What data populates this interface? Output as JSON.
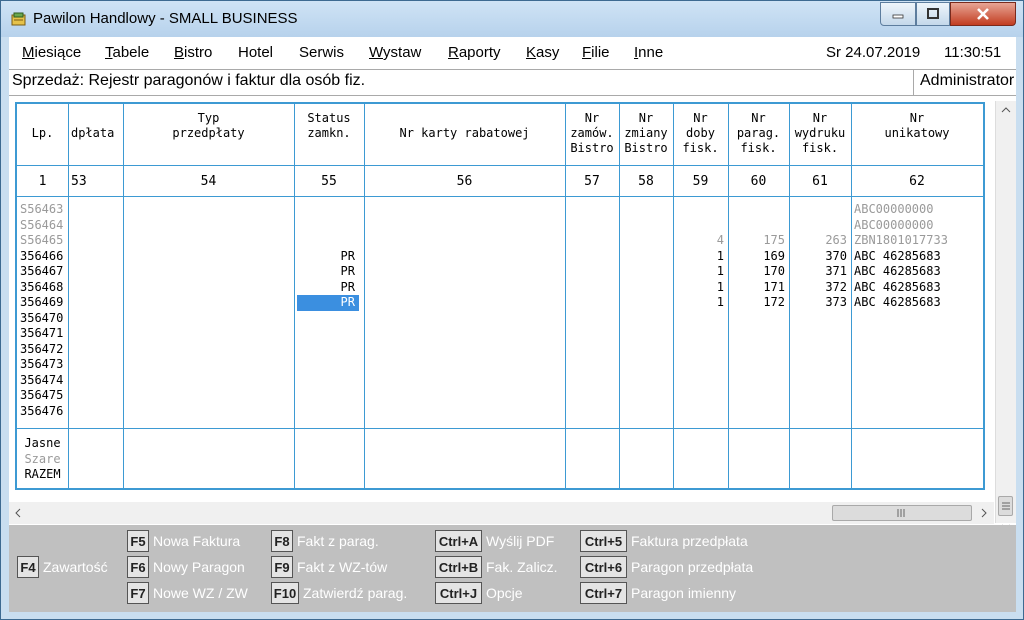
{
  "window": {
    "title": "Pawilon Handlowy - SMALL BUSINESS"
  },
  "menu": {
    "items": [
      {
        "label": "Miesiące",
        "u": "M",
        "rest": "iesiące"
      },
      {
        "label": "Tabele",
        "u": "T",
        "rest": "abele"
      },
      {
        "label": "Bistro",
        "u": "B",
        "rest": "istro"
      },
      {
        "label": "Hotel",
        "u": "",
        "rest": "Hotel"
      },
      {
        "label": "Serwis",
        "u": "",
        "rest": "Serwis"
      },
      {
        "label": "Wystaw",
        "u": "W",
        "rest": "ystaw"
      },
      {
        "label": "Raporty",
        "u": "R",
        "rest": "aporty"
      },
      {
        "label": "Kasy",
        "u": "K",
        "rest": "asy"
      },
      {
        "label": "Filie",
        "u": "F",
        "rest": "ilie"
      },
      {
        "label": "Inne",
        "u": "I",
        "rest": "nne"
      }
    ],
    "date": "Sr 24.07.2019",
    "time": "11:30:51"
  },
  "status": {
    "title": "Sprzedaż: Rejestr paragonów i faktur dla osób fiz.",
    "user": "Administrator"
  },
  "grid": {
    "headers": [
      "Lp.",
      "dpłata",
      "Typ\nprzedpłaty",
      "Status\nzamkn.",
      "Nr karty rabatowej",
      "Nr\nzamów.\nBistro",
      "Nr\nzmiany\nBistro",
      "Nr\ndoby\nfisk.",
      "Nr\nparag.\nfisk.",
      "Nr\nwydruku\nfisk.",
      "Nr\nunikatowy"
    ],
    "numbers": [
      "1",
      "53",
      "54",
      "55",
      "56",
      "57",
      "58",
      "59",
      "60",
      "61",
      "62"
    ],
    "rows": [
      {
        "lp": "S56463",
        "status": "",
        "doby": "",
        "parag": "",
        "wydruk": "",
        "unik": "ABC00000000",
        "grey": true
      },
      {
        "lp": "S56464",
        "status": "",
        "doby": "",
        "parag": "",
        "wydruk": "",
        "unik": "ABC00000000",
        "grey": true
      },
      {
        "lp": "S56465",
        "status": "",
        "doby": "4",
        "parag": "175",
        "wydruk": "263",
        "unik": "ZBN1801017733",
        "grey": true
      },
      {
        "lp": "356466",
        "status": "PR",
        "doby": "1",
        "parag": "169",
        "wydruk": "370",
        "unik": "ABC 46285683",
        "grey": false
      },
      {
        "lp": "356467",
        "status": "PR",
        "doby": "1",
        "parag": "170",
        "wydruk": "371",
        "unik": "ABC 46285683",
        "grey": false
      },
      {
        "lp": "356468",
        "status": "PR",
        "doby": "1",
        "parag": "171",
        "wydruk": "372",
        "unik": "ABC 46285683",
        "grey": false
      },
      {
        "lp": "356469",
        "status": "PR",
        "doby": "1",
        "parag": "172",
        "wydruk": "373",
        "unik": "ABC 46285683",
        "grey": false,
        "selected": true
      },
      {
        "lp": "356470",
        "status": "",
        "doby": "",
        "parag": "",
        "wydruk": "",
        "unik": "",
        "grey": false
      },
      {
        "lp": "356471",
        "status": "",
        "doby": "",
        "parag": "",
        "wydruk": "",
        "unik": "",
        "grey": false
      },
      {
        "lp": "356472",
        "status": "",
        "doby": "",
        "parag": "",
        "wydruk": "",
        "unik": "",
        "grey": false
      },
      {
        "lp": "356473",
        "status": "",
        "doby": "",
        "parag": "",
        "wydruk": "",
        "unik": "",
        "grey": false
      },
      {
        "lp": "356474",
        "status": "",
        "doby": "",
        "parag": "",
        "wydruk": "",
        "unik": "",
        "grey": false
      },
      {
        "lp": "356475",
        "status": "",
        "doby": "",
        "parag": "",
        "wydruk": "",
        "unik": "",
        "grey": false
      },
      {
        "lp": "356476",
        "status": "",
        "doby": "",
        "parag": "",
        "wydruk": "",
        "unik": "",
        "grey": false
      }
    ],
    "legend": [
      {
        "label": "Jasne",
        "grey": false
      },
      {
        "label": "Szare",
        "grey": true
      },
      {
        "label": "RAZEM",
        "grey": false
      }
    ]
  },
  "fkeys": [
    {
      "key": "F4",
      "label": "Zawartość"
    },
    {
      "key": "F5",
      "label": "Nowa Faktura"
    },
    {
      "key": "F6",
      "label": "Nowy Paragon"
    },
    {
      "key": "F7",
      "label": "Nowe WZ / ZW"
    },
    {
      "key": "F8",
      "label": "Fakt z parag."
    },
    {
      "key": "F9",
      "label": "Fakt z WZ-tów"
    },
    {
      "key": "F10",
      "label": "Zatwierdź parag."
    },
    {
      "key": "Ctrl+A",
      "label": "Wyślij PDF"
    },
    {
      "key": "Ctrl+B",
      "label": "Fak. Zalicz."
    },
    {
      "key": "Ctrl+J",
      "label": "Opcje"
    },
    {
      "key": "Ctrl+5",
      "label": "Faktura przedpłata"
    },
    {
      "key": "Ctrl+6",
      "label": "Paragon przedpłata"
    },
    {
      "key": "Ctrl+7",
      "label": "Paragon imienny"
    }
  ],
  "colors": {
    "grid_line": "#3d9ad3",
    "selection": "#3b8fe0",
    "fkey_bar": "#c0c0c0"
  }
}
